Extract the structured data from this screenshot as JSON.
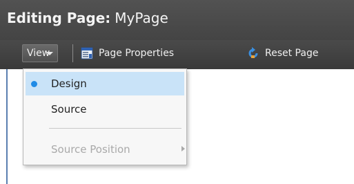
{
  "header": {
    "title_prefix": "Editing Page:",
    "title_name": "MyPage"
  },
  "toolbar": {
    "view_label": "View",
    "page_properties_label": "Page Properties",
    "reset_page_label": "Reset Page"
  },
  "view_menu": {
    "items": [
      {
        "label": "Design",
        "selected": true,
        "enabled": true
      },
      {
        "label": "Source",
        "selected": false,
        "enabled": true
      },
      {
        "label": "Source Position",
        "selected": false,
        "enabled": false,
        "has_submenu": true
      }
    ]
  },
  "colors": {
    "header_bg": "#474747",
    "selected_item_bg": "#c9e3f8",
    "selection_dot": "#1f8be6",
    "disabled_text": "#a9a9a9"
  }
}
